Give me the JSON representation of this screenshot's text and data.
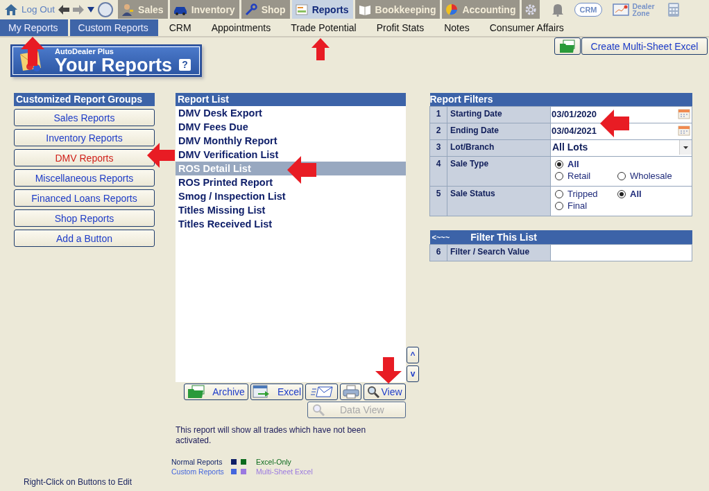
{
  "top_bar": {
    "log_out": "Log Out",
    "tabs": [
      {
        "kind": "sales",
        "label": "Sales",
        "selected": false
      },
      {
        "kind": "inventory",
        "label": "Inventory",
        "selected": false
      },
      {
        "kind": "shop",
        "label": "Shop",
        "selected": false
      },
      {
        "kind": "reports",
        "label": "Reports",
        "selected": true
      },
      {
        "kind": "bookkeeping",
        "label": "Bookkeeping",
        "selected": false
      },
      {
        "kind": "accounting",
        "label": "Accounting",
        "selected": false
      }
    ],
    "crm": "CRM",
    "dealer_zone": "Dealer Zone"
  },
  "nav": [
    {
      "label": "My Reports",
      "selected": true
    },
    {
      "label": "Custom Reports",
      "selected": true
    },
    {
      "label": "CRM",
      "selected": false
    },
    {
      "label": "Appointments",
      "selected": false
    },
    {
      "label": "Trade Potential",
      "selected": false
    },
    {
      "label": "Profit Stats",
      "selected": false
    },
    {
      "label": "Notes",
      "selected": false
    },
    {
      "label": "Consumer Affairs",
      "selected": false
    }
  ],
  "banner": {
    "brand": "AutoDealer Plus",
    "title": "Your Reports",
    "help": "?"
  },
  "create_button": "Create Multi-Sheet Excel",
  "report_groups": {
    "title": "Customized Report Groups",
    "items": [
      {
        "label": "Sales Reports",
        "selected": false
      },
      {
        "label": "Inventory Reports",
        "selected": false
      },
      {
        "label": "DMV Reports",
        "selected": true
      },
      {
        "label": "Miscellaneous Reports",
        "selected": false
      },
      {
        "label": "Financed Loans Reports",
        "selected": false
      },
      {
        "label": "Shop Reports",
        "selected": false
      },
      {
        "label": "Add a Button",
        "selected": false
      }
    ]
  },
  "report_list": {
    "title": "Report List",
    "items": [
      {
        "label": "DMV Desk Export",
        "selected": false
      },
      {
        "label": "DMV Fees Due",
        "selected": false
      },
      {
        "label": "DMV Monthly Report",
        "selected": false
      },
      {
        "label": "DMV Verification List",
        "selected": false
      },
      {
        "label": "ROS Detail List",
        "selected": true
      },
      {
        "label": "ROS Printed Report",
        "selected": false
      },
      {
        "label": "Smog / Inspection List",
        "selected": false
      },
      {
        "label": "Titles Missing List",
        "selected": false
      },
      {
        "label": "Titles Received List",
        "selected": false
      }
    ],
    "scroll_up": "^",
    "scroll_down": "v"
  },
  "actions": [
    {
      "kind": "archive",
      "label": "Archive"
    },
    {
      "kind": "excel",
      "label": "Excel"
    },
    {
      "kind": "email"
    },
    {
      "kind": "print"
    },
    {
      "kind": "view",
      "label": "View"
    }
  ],
  "data_view": {
    "label": "Data View",
    "disabled": true
  },
  "description": "This report will show all trades which have not been activated.",
  "legend": [
    {
      "label": "Normal Reports",
      "color": "#0d1f66"
    },
    {
      "label": "Excel-Only",
      "color": "#0b6a1c"
    },
    {
      "label": "Custom Reports",
      "color": "#4466dd"
    },
    {
      "label": "Multi-Sheet Excel",
      "color": "#9a78e0"
    }
  ],
  "filters": {
    "title": "Report Filters",
    "rows": [
      {
        "number": "1",
        "label": "Starting Date",
        "kind": "date",
        "value": "03/01/2020"
      },
      {
        "number": "2",
        "label": "Ending Date",
        "kind": "date",
        "value": "03/04/2021"
      },
      {
        "number": "3",
        "label": "Lot/Branch",
        "kind": "select",
        "value": "All Lots"
      },
      {
        "number": "4",
        "label": "Sale Type",
        "kind": "radio",
        "options": [
          {
            "label": "All",
            "selected": true,
            "full_row": true
          },
          {
            "label": "Retail",
            "selected": false,
            "full_row": false
          },
          {
            "label": "Wholesale",
            "selected": false,
            "full_row": false
          }
        ]
      },
      {
        "number": "5",
        "label": "Sale Status",
        "kind": "radio",
        "options": [
          {
            "label": "Tripped",
            "selected": false,
            "full_row": false
          },
          {
            "label": "All",
            "selected": true,
            "full_row": false
          },
          {
            "label": "Final",
            "selected": false,
            "full_row": false
          }
        ]
      }
    ]
  },
  "filter_list": {
    "back": "<~~~",
    "title": "Filter This List",
    "rows": [
      {
        "number": "6",
        "label": "Filter / Search Value"
      }
    ]
  },
  "hint": "Right-Click on Buttons to Edit"
}
